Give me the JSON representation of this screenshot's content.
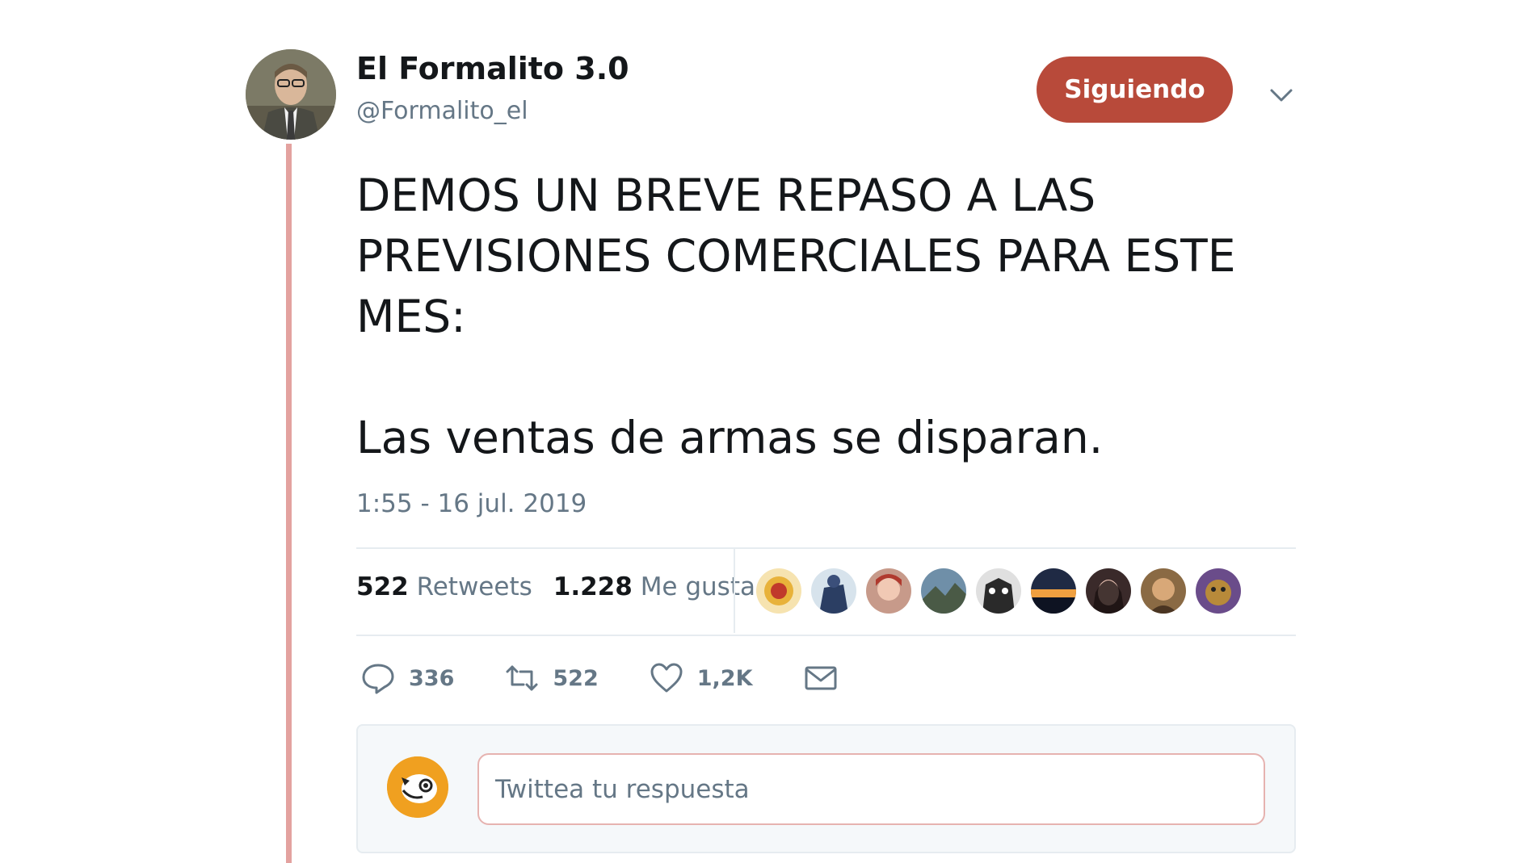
{
  "author": {
    "name": "El Formalito 3.0",
    "handle": "@Formalito_el"
  },
  "follow_button": {
    "label": "Siguiendo",
    "color": "#b84a3a"
  },
  "tweet": {
    "text_lines": "DEMOS UN BREVE REPASO A LAS\nPREVISIONES COMERCIALES PARA ESTE\nMES:",
    "text_last": "Las ventas de armas se disparan.",
    "timestamp": "1:55 - 16 jul. 2019"
  },
  "stats": {
    "retweets_count": "522",
    "retweets_label": "Retweets",
    "likes_count": "1.228",
    "likes_label": "Me gusta"
  },
  "likers": [
    "liker-1",
    "liker-2",
    "liker-3",
    "liker-4",
    "liker-5",
    "liker-6",
    "liker-7",
    "liker-8",
    "liker-9"
  ],
  "actions": {
    "reply_count": "336",
    "retweet_count": "522",
    "like_count": "1,2K"
  },
  "reply": {
    "placeholder": "Twittea tu respuesta"
  },
  "icons": [
    "reply-icon",
    "retweet-icon",
    "heart-icon",
    "mail-icon",
    "chevron-down-icon"
  ],
  "colors": {
    "thread_line": "#e3a29f",
    "muted_text": "#657786"
  }
}
